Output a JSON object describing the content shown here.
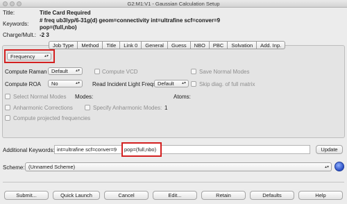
{
  "window": {
    "title": "G2:M1:V1 - Gaussian Calculation Setup"
  },
  "header": {
    "title_label": "Title:",
    "title_value": "Title Card Required",
    "keywords_label": "Keywords:",
    "keywords_line1": "# freq ub3lyp/6-31g(d) geom=connectivity int=ultrafine scf=conver=9",
    "keywords_line2": "pop=(full,nbo)",
    "charge_label": "Charge/Mult.:",
    "charge_value": "-2 3"
  },
  "tabs": [
    "Job Type",
    "Method",
    "Title",
    "Link 0",
    "General",
    "Guess",
    "NBO",
    "PBC",
    "Solvation",
    "Add. Inp."
  ],
  "jobtype": {
    "selected": "Frequency",
    "compute_raman_label": "Compute Raman",
    "compute_raman_value": "Default",
    "compute_vcd_label": "Compute VCD",
    "save_normal_modes_label": "Save Normal Modes",
    "compute_roa_label": "Compute ROA",
    "compute_roa_value": "No",
    "incident_light_label": "Read Incident Light Freqs",
    "incident_light_value": "Default",
    "skip_diag_label": "Skip diag. of full matrix",
    "select_normal_modes_label": "Select Normal Modes",
    "modes_label": "Modes:",
    "atoms_label": "Atoms:",
    "anharmonic_label": "Anharmonic Corrections",
    "specify_anharmonic_label": "Specify Anharmonic Modes:",
    "specify_anharmonic_value": "1",
    "projected_freq_label": "Compute projected frequencies"
  },
  "additional": {
    "label": "Additional Keywords:",
    "value_part1": "int=ultrafine scf=conver=9",
    "value_part2": "pop=(full,nbo)",
    "update_button": "Update"
  },
  "scheme": {
    "label": "Scheme:",
    "value": "(Unnamed Scheme)"
  },
  "buttons": {
    "submit": "Submit...",
    "quick_launch": "Quick Launch",
    "cancel": "Cancel",
    "edit": "Edit...",
    "retain": "Retain",
    "defaults": "Defaults",
    "help": "Help"
  },
  "colors": {
    "highlight": "#d32020",
    "scheme_icon": "#2b4fc4"
  }
}
